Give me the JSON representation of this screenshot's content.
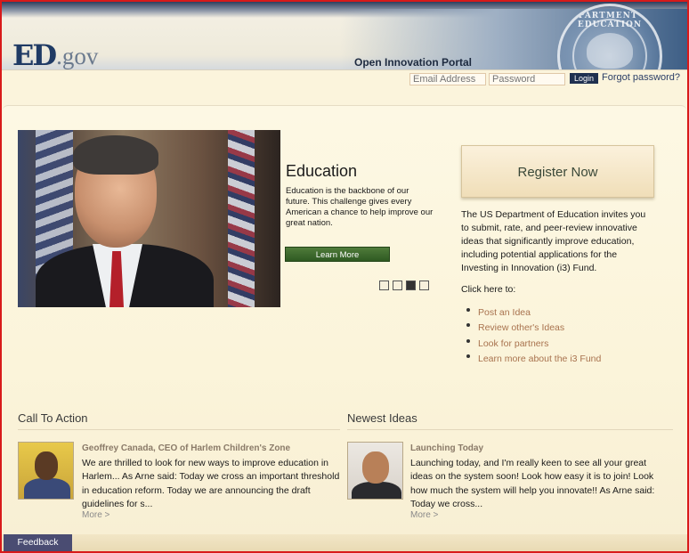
{
  "header": {
    "logo_ed": "ED",
    "logo_gov": ".gov",
    "portal_title": "Open Innovation Portal",
    "seal_text": "DEPARTMENT OF EDUCATION"
  },
  "login": {
    "email_placeholder": "Email Address",
    "password_placeholder": "Password",
    "login_label": "Login",
    "forgot_label": "Forgot password?"
  },
  "hero": {
    "title": "Education",
    "text": "Education is the backbone of our future. This challenge gives every American a chance to help improve our great nation.",
    "button_label": "Learn More",
    "slides": [
      false,
      false,
      true,
      false
    ]
  },
  "sidebar": {
    "register_label": "Register Now",
    "intro": "The US Department of Education invites you to submit, rate, and peer-review innovative ideas that significantly improve education, including potential applications for the Investing in Innovation (i3) Fund.",
    "click_here": "Click here to:",
    "actions": [
      "Post an Idea",
      "Review other's Ideas",
      "Look for partners",
      "Learn more about the i3 Fund"
    ]
  },
  "call_to_action": {
    "heading": "Call To Action",
    "title": "Geoffrey Canada, CEO of Harlem Children's Zone",
    "text": "We are thrilled to look for new ways to improve education in Harlem... As Arne said: Today we cross an important threshold in education reform. Today we are announcing the draft guidelines for s...",
    "more": "More >"
  },
  "newest_ideas": {
    "heading": "Newest Ideas",
    "title": "Launching Today",
    "text": "Launching today, and I'm really keen to see all your great ideas on the system soon! Look how easy it is to join! Look how much the system will help you innovate!! As Arne said: Today we cross...",
    "more": "More >"
  },
  "footer": {
    "feedback_label": "Feedback"
  },
  "colors": {
    "frame_border": "#d81a1a",
    "page_bg": "#fbf4dc",
    "link": "#a8724e",
    "button_green": "#3a6a2c",
    "feedback_bg": "#4a4c72"
  }
}
